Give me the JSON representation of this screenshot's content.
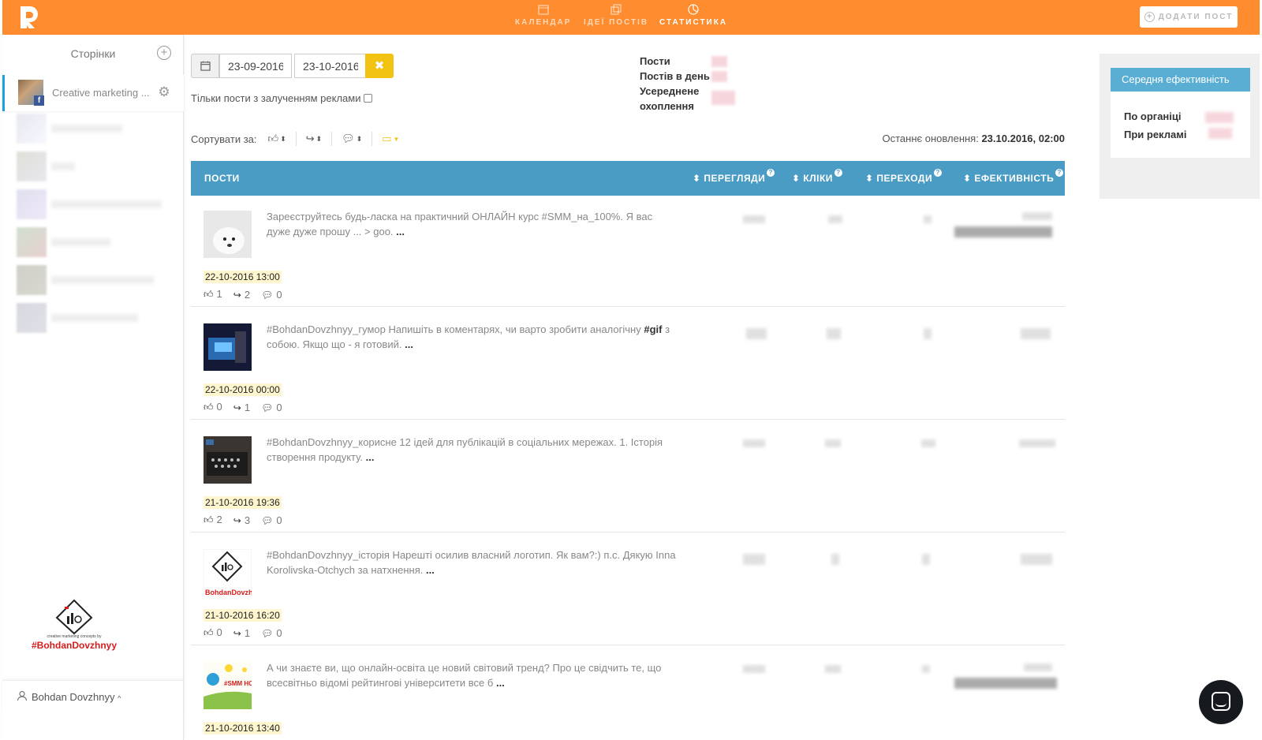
{
  "topbar": {
    "nav": [
      {
        "label": "КАЛЕНДАР",
        "icon": "calendar-icon"
      },
      {
        "label": "ІДЕЇ ПОСТІВ",
        "icon": "copy-icon"
      },
      {
        "label": "СТАТИСТИКА",
        "icon": "pie-chart-icon",
        "active": true
      }
    ],
    "add_post_label": "ДОДАТИ ПОСТ",
    "accent": "#ff8c2e"
  },
  "sidebar": {
    "title": "Сторінки",
    "active_page": "Creative marketing ...",
    "logo_text": "#BohdanDovzhnyy",
    "logo_small": "creative marketing concepts by",
    "user_name": "Bohdan Dovzhnyy"
  },
  "filters": {
    "date_from": "23-09-2016",
    "date_to": "23-10-2016",
    "ads_only_label": "Тільки пости з залученням реклами"
  },
  "summary": {
    "labels": [
      "Пости",
      "Постів в день",
      "Усереднене охоплення"
    ]
  },
  "sort": {
    "label": "Сортувати за:"
  },
  "updated": {
    "label": "Останнє оновлення:",
    "value": "23.10.2016, 02:00"
  },
  "table": {
    "headers": [
      "ПОСТИ",
      "ПЕРЕГЛЯДИ",
      "КЛІКИ",
      "ПЕРЕХОДИ",
      "ЕФЕКТИВНІСТЬ"
    ],
    "header_color": "#4a9cc5"
  },
  "posts": [
    {
      "text": "Зареєструйтесь будь-ласка на практичний ОНЛАЙН курс #SMM_на_100%. Я вас дуже дуже прошу ... > goo.",
      "more": "...",
      "date": "22-10-2016 13:00",
      "likes": "1",
      "shares": "2",
      "comments": "0"
    },
    {
      "text_before": "#BohdanDovzhnyy_гумор Напишіть в коментарях, чи варто зробити аналогічну ",
      "text_bold": "#gif",
      "text_after": " з собою. Якщо що - я готовий.",
      "more": "...",
      "date": "22-10-2016 00:00",
      "likes": "0",
      "shares": "1",
      "comments": "0"
    },
    {
      "text": "#BohdanDovzhnyy_корисне 12 ідей для публікацій в соціальних мережах. 1. Історія створення продукту.",
      "more": "...",
      "date": "21-10-2016 19:36",
      "likes": "2",
      "shares": "3",
      "comments": "0"
    },
    {
      "text": "#BohdanDovzhnyy_історія Нарешті осилив власний логотип. Як вам?:) п.с. Дякую Inna Korolivska-Otchych за натхнення.",
      "more": "...",
      "date": "21-10-2016 16:20",
      "likes": "0",
      "shares": "1",
      "comments": "0",
      "thumb_brand": "BohdanDovzh"
    },
    {
      "text": "А чи знаєте ви, що онлайн-освіта це новий світовий тренд? Про це свідчить те, що всесвітньо відомі рейтингові університети все б",
      "more": "...",
      "date": "21-10-2016 13:40",
      "thumb_brand": "#SMM НО"
    }
  ],
  "right_panel": {
    "title": "Середня ефективність",
    "rows": [
      "По органіці",
      "При рекламі"
    ],
    "header_color": "#5aaed4"
  }
}
